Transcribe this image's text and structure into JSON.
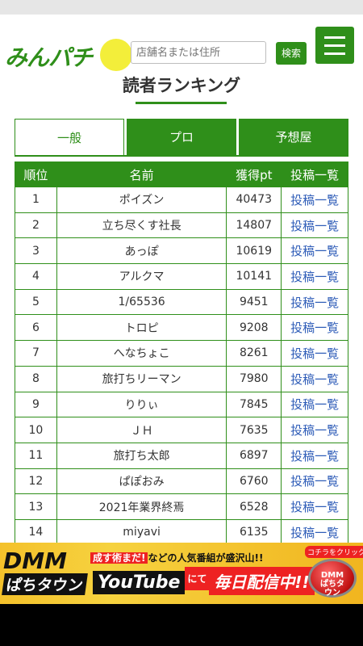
{
  "header": {
    "logo_text": "みんパチ",
    "search_placeholder": "店舗名または住所",
    "search_button": "検索",
    "menu_icon": "hamburger-menu-icon"
  },
  "page_title": "読者ランキング",
  "tabs": [
    {
      "label": "一般",
      "active": true
    },
    {
      "label": "プロ",
      "active": false
    },
    {
      "label": "予想屋",
      "active": false
    }
  ],
  "table": {
    "headers": [
      "順位",
      "名前",
      "獲得pt",
      "投稿一覧"
    ],
    "rows": [
      {
        "rank": "1",
        "name": "ポイズン",
        "points": "40473",
        "link": "投稿一覧"
      },
      {
        "rank": "2",
        "name": "立ち尽くす社長",
        "points": "14807",
        "link": "投稿一覧"
      },
      {
        "rank": "3",
        "name": "あっぽ",
        "points": "10619",
        "link": "投稿一覧"
      },
      {
        "rank": "4",
        "name": "アルクマ",
        "points": "10141",
        "link": "投稿一覧"
      },
      {
        "rank": "5",
        "name": "1/65536",
        "points": "9451",
        "link": "投稿一覧"
      },
      {
        "rank": "6",
        "name": "トロピ",
        "points": "9208",
        "link": "投稿一覧"
      },
      {
        "rank": "7",
        "name": "へなちょこ",
        "points": "8261",
        "link": "投稿一覧"
      },
      {
        "rank": "8",
        "name": "旅打ちリーマン",
        "points": "7980",
        "link": "投稿一覧"
      },
      {
        "rank": "9",
        "name": "りりぃ",
        "points": "7845",
        "link": "投稿一覧"
      },
      {
        "rank": "10",
        "name": "ＪＨ",
        "points": "7635",
        "link": "投稿一覧"
      },
      {
        "rank": "11",
        "name": "旅打ち太郎",
        "points": "6897",
        "link": "投稿一覧"
      },
      {
        "rank": "12",
        "name": "ぱぽおみ",
        "points": "6760",
        "link": "投稿一覧"
      },
      {
        "rank": "13",
        "name": "2021年業界終焉",
        "points": "6528",
        "link": "投稿一覧"
      },
      {
        "rank": "14",
        "name": "miyavi",
        "points": "6135",
        "link": "投稿一覧"
      }
    ]
  },
  "ad": {
    "brand_top": "DMM",
    "brand_bottom": "ぱちタウン",
    "tagline_highlight": "成す術まだ!",
    "tagline_rest": "などの人気番組が盛沢山!!",
    "youtube": "YouTube",
    "ni": "にて",
    "daily": "毎日配信中!!",
    "click_caption": "コチラをクリック!!",
    "button_text": "DMMぱちタウン"
  },
  "colors": {
    "brand_green": "#2f8f1a",
    "link_blue": "#2f5db8",
    "ad_yellow": "#f4c12b"
  }
}
